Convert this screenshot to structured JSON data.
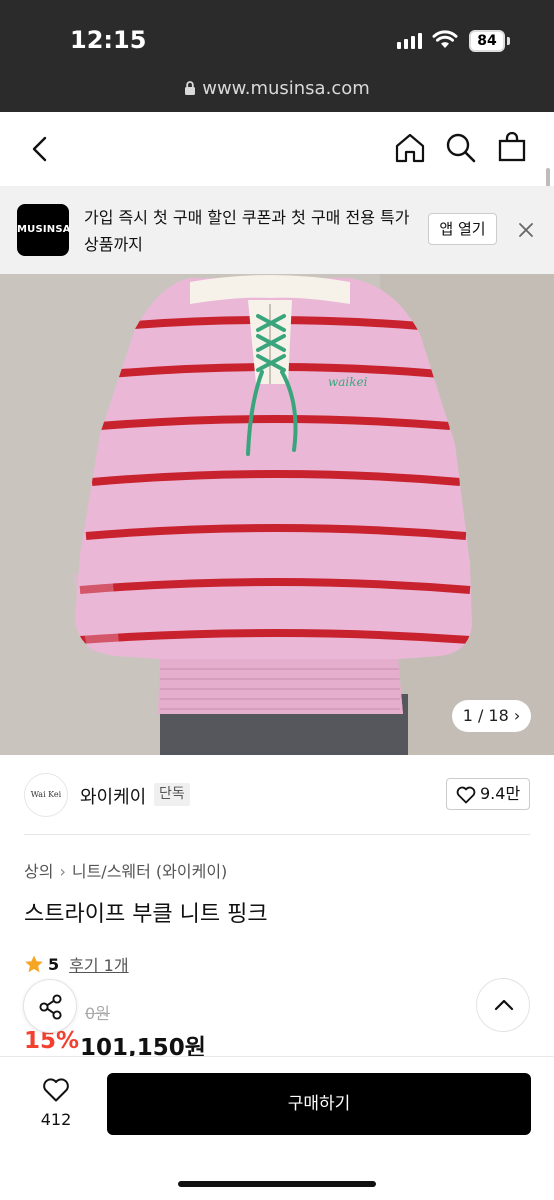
{
  "status": {
    "time": "12:15",
    "battery": "84"
  },
  "browser": {
    "url": "www.musinsa.com"
  },
  "header": {
    "icons": [
      "back-icon",
      "home-icon",
      "search-icon",
      "shopping-bag-icon"
    ]
  },
  "banner": {
    "app_logo": "MUSINSA",
    "text": "가입 즉시 첫 구매 할인 쿠폰과 첫 구매 전용 특가 상품까지",
    "open_label": "앱 열기"
  },
  "gallery": {
    "counter": "1 / 18",
    "current": 1,
    "total": 18,
    "tag_text": "waikei"
  },
  "brand": {
    "logo_text": "Wai Kei",
    "name": "와이케이",
    "badge": "단독",
    "likes": "9.4만"
  },
  "breadcrumb": {
    "level1": "상의",
    "level2": "니트/스웨터 (와이케이)"
  },
  "product": {
    "title": "스트라이프 부클 니트 핑크",
    "rating": "5",
    "reviews": "후기 1개",
    "original_price_fragment": "0원",
    "discount": "15%",
    "price": "101,150원"
  },
  "bottom": {
    "wish_count": "412",
    "buy_label": "구매하기"
  },
  "colors": {
    "accent_red": "#f3402f",
    "buy_button": "#000000",
    "star": "#f5a623",
    "sweater_pink": "#eab8d6",
    "stripe_red": "#c8222f",
    "lace_green": "#3aa57d"
  }
}
